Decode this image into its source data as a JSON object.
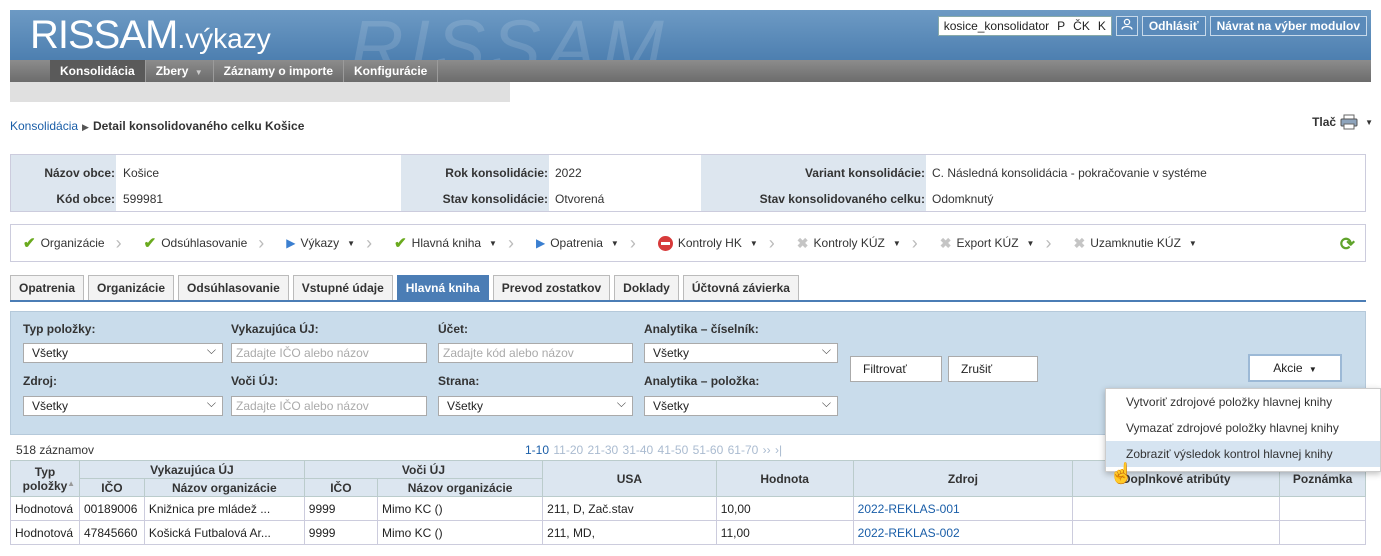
{
  "header": {
    "logo_main": "RISSAM",
    "logo_suffix": ".výkazy",
    "bg_text": "RISSAM",
    "username": "kosice_konsolidator",
    "flags": [
      "P",
      "ČK",
      "K"
    ],
    "logout": "Odhlásiť",
    "back": "Návrat na výber modulov"
  },
  "nav": {
    "items": [
      "Konsolidácia",
      "Zbery",
      "Záznamy o importe",
      "Konfigurácie"
    ]
  },
  "breadcrumb": {
    "root": "Konsolidácia",
    "current": "Detail konsolidovaného celku Košice"
  },
  "print_label": "Tlač",
  "info": {
    "nazov_label": "Názov obce:",
    "nazov": "Košice",
    "kod_label": "Kód obce:",
    "kod": "599981",
    "rok_label": "Rok konsolidácie:",
    "rok": "2022",
    "stav_label": "Stav konsolidácie:",
    "stav": "Otvorená",
    "variant_label": "Variant konsolidácie:",
    "variant": "C. Následná konsolidácia - pokračovanie v systéme",
    "stavcelku_label": "Stav konsolidovaného celku:",
    "stavcelku": "Odomknutý"
  },
  "steps": [
    "Organizácie",
    "Odsúhlasovanie",
    "Výkazy",
    "Hlavná kniha",
    "Opatrenia",
    "Kontroly HK",
    "Kontroly KÚZ",
    "Export KÚZ",
    "Uzamknutie KÚZ"
  ],
  "tabs": [
    "Opatrenia",
    "Organizácie",
    "Odsúhlasovanie",
    "Vstupné údaje",
    "Hlavná kniha",
    "Prevod zostatkov",
    "Doklady",
    "Účtovná závierka"
  ],
  "filter": {
    "typ_label": "Typ položky:",
    "typ_value": "Všetky",
    "vyk_label": "Vykazujúca ÚJ:",
    "vyk_placeholder": "Zadajte IČO alebo názov",
    "ucet_label": "Účet:",
    "ucet_placeholder": "Zadajte kód alebo názov",
    "anal_label": "Analytika – číselník:",
    "anal_value": "Všetky",
    "zdroj_label": "Zdroj:",
    "zdroj_value": "Všetky",
    "voci_label": "Voči ÚJ:",
    "voci_placeholder": "Zadajte IČO alebo názov",
    "strana_label": "Strana:",
    "strana_value": "Všetky",
    "analp_label": "Analytika – položka:",
    "analp_value": "Všetky",
    "filter_btn": "Filtrovať",
    "cancel_btn": "Zrušiť",
    "akcie_btn": "Akcie"
  },
  "count": "518 záznamov",
  "pager": {
    "current": "1-10",
    "rest": "11-20 21-30 31-40 41-50 51-60 61-70",
    "next": "››",
    "last": "›|"
  },
  "table": {
    "h_typ": "Typ položky",
    "h_vyk": "Vykazujúca ÚJ",
    "h_voci": "Voči ÚJ",
    "h_ico": "IČO",
    "h_nazov": "Názov organizácie",
    "h_usa": "USA",
    "h_hodnota": "Hodnota",
    "h_zdroj": "Zdroj",
    "h_doplnkove": "Doplnkové atribúty",
    "h_poznamka": "Poznámka",
    "rows": [
      [
        "Hodnotová",
        "00189006",
        "Knižnica pre mládež ...",
        "9999",
        "Mimo KC ()",
        "211, D, Zač.stav",
        "10,00",
        "2022-REKLAS-001",
        "",
        ""
      ],
      [
        "Hodnotová",
        "47845660",
        "Košická Futbalová Ar...",
        "9999",
        "Mimo KC ()",
        "211, MD,",
        "11,00",
        "2022-REKLAS-002",
        "",
        ""
      ]
    ]
  },
  "menu": [
    "Vytvoriť zdrojové položky hlavnej knihy",
    "Vymazať zdrojové položky hlavnej knihy",
    "Zobraziť výsledok kontrol hlavnej knihy"
  ]
}
